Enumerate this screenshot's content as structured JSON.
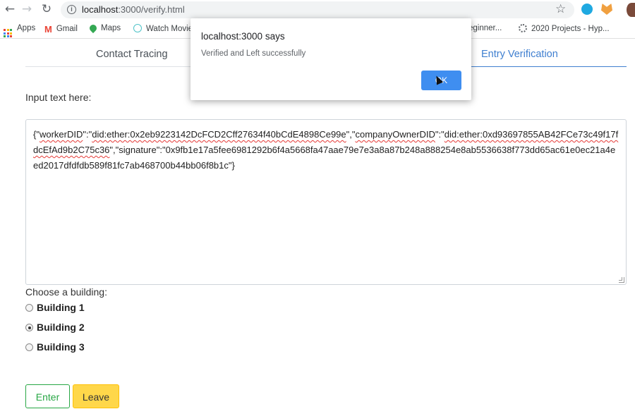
{
  "browser": {
    "url_host": "localhost",
    "url_path": ":3000/verify.html",
    "bookmarks": [
      {
        "label": "Apps",
        "icon": "apps-grid-icon"
      },
      {
        "label": "Gmail",
        "icon": "gmail-icon"
      },
      {
        "label": "Maps",
        "icon": "maps-icon"
      },
      {
        "label": "Watch Movie",
        "icon": "watch-movie-icon"
      },
      {
        "label": "eginner...",
        "icon": "bookmark-icon"
      },
      {
        "label": "2020 Projects - Hyp...",
        "icon": "gear-icon"
      }
    ]
  },
  "tabs": {
    "contact": "Contact Tracing",
    "entry": "Entry Verification"
  },
  "form": {
    "input_label": "Input text here:",
    "text_parts": {
      "p1": "{\"",
      "worker_key": "workerDID",
      "p2": "\":\"",
      "worker_val": "did:ether:0x2eb9223142DcFCD2Cff27634f40bCdE4898Ce99e",
      "p3": "\",\"",
      "owner_key": "companyOwnerDID",
      "p4": "\":\"",
      "owner_val": "did:ether:0xd93697855AB42FCe73c49f17fdcEfAd9b2C75c36",
      "p5": "\",\"signature\":\"0x9fb1e17a5fee6981292b6f4a5668fa47aae79e7e3a8a87b248a888254e8ab5536638f773dd65ac61e0ec21a4eed2017dfdfdb589f81fc7ab468700b44bb06f8b1c\"}"
    },
    "building_label": "Choose a building:",
    "buildings": [
      {
        "label": "Building 1",
        "checked": false
      },
      {
        "label": "Building 2",
        "checked": true
      },
      {
        "label": "Building 3",
        "checked": false
      }
    ],
    "enter_label": "Enter",
    "leave_label": "Leave"
  },
  "dialog": {
    "title": "localhost:3000 says",
    "message": "Verified and Left successfully",
    "ok_label": "OK"
  },
  "colors": {
    "accent": "#3f7fd0",
    "enter": "#28a745",
    "leave": "#ffd74a",
    "dialog_ok": "#3f8ef0"
  }
}
